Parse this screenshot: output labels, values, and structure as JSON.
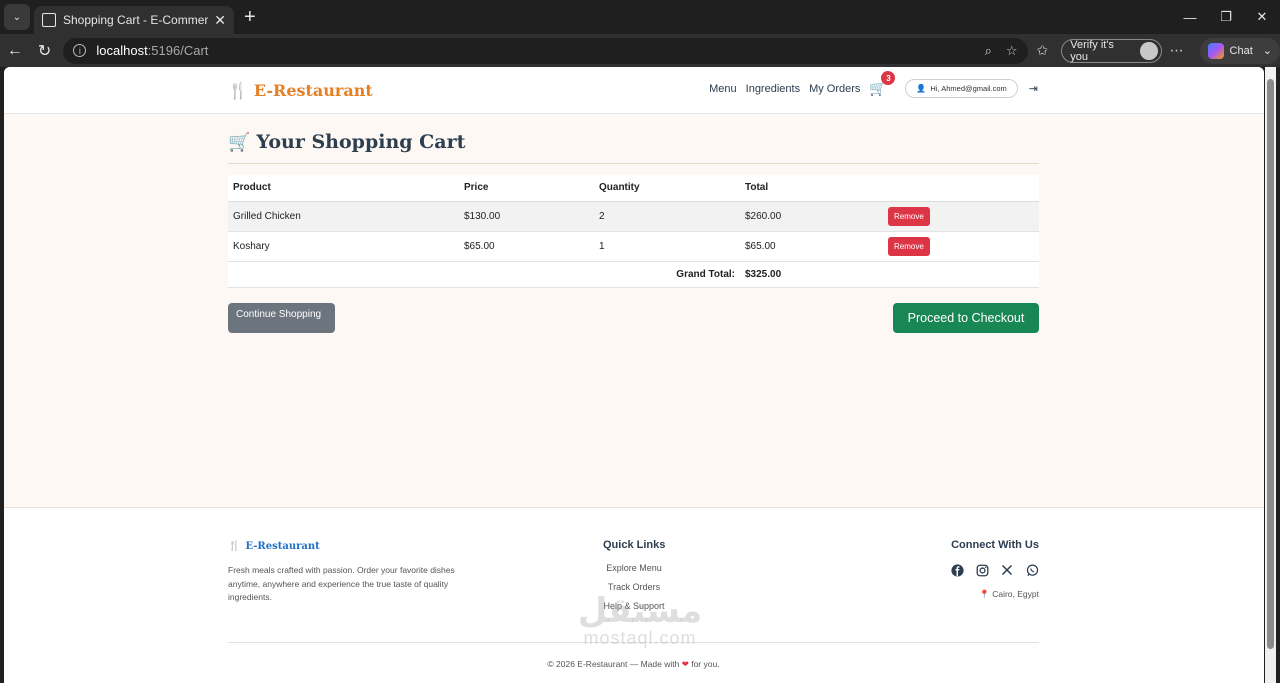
{
  "browser": {
    "tab_title": "Shopping Cart - E-Commerce Resta",
    "url_host": "localhost",
    "url_path": ":5196/Cart",
    "verify_label": "Verify it's you",
    "chat_label": "Chat"
  },
  "nav": {
    "brand": "E-Restaurant",
    "links": [
      "Menu",
      "Ingredients",
      "My Orders"
    ],
    "cart_count": "3",
    "user_greeting": "Hi, Ahmed@gmail.com"
  },
  "cart": {
    "title": "Your Shopping Cart",
    "headers": [
      "Product",
      "Price",
      "Quantity",
      "Total"
    ],
    "items": [
      {
        "product": "Grilled Chicken",
        "price": "$130.00",
        "quantity": "2",
        "total": "$260.00",
        "remove": "Remove"
      },
      {
        "product": "Koshary",
        "price": "$65.00",
        "quantity": "1",
        "total": "$65.00",
        "remove": "Remove"
      }
    ],
    "grand_total_label": "Grand Total:",
    "grand_total_value": "$325.00",
    "continue_label": "Continue Shopping",
    "checkout_label": "Proceed to Checkout"
  },
  "footer": {
    "brand": "E-Restaurant",
    "description": "Fresh meals crafted with passion. Order your favorite dishes anytime, anywhere and experience the true taste of quality ingredients.",
    "quick_links_title": "Quick Links",
    "quick_links": [
      "Explore Menu",
      "Track Orders",
      "Help & Support"
    ],
    "connect_title": "Connect With Us",
    "social_icons": [
      "facebook-icon",
      "instagram-icon",
      "x-icon",
      "whatsapp-icon"
    ],
    "location": "Cairo, Egypt",
    "copyright_prefix": "© 2026 E-Restaurant — Made with",
    "copyright_suffix": "for you."
  },
  "watermark": {
    "arabic": "مستقل",
    "latin": "mostaql.com"
  },
  "colors": {
    "brand_orange": "#e67e22",
    "remove_red": "#dc3545",
    "checkout_green": "#198754",
    "continue_gray": "#6c757d",
    "footer_brand_blue": "#1f6fc5"
  }
}
